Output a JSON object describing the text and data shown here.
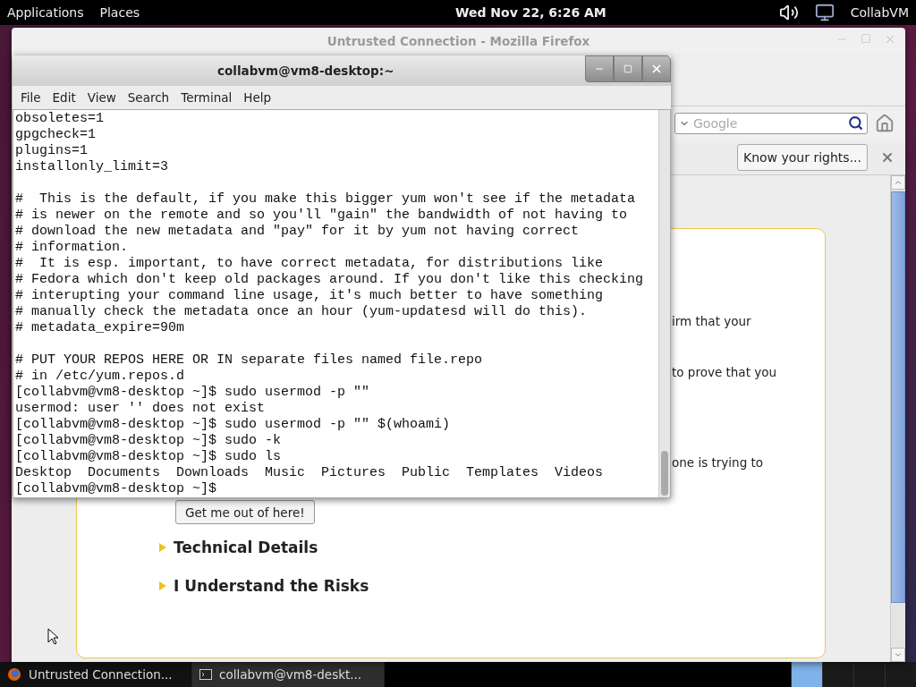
{
  "top_panel": {
    "menus": [
      "Applications",
      "Places"
    ],
    "clock": "Wed Nov 22,  6:26 AM",
    "user": "CollabVM"
  },
  "firefox": {
    "title": "Untrusted Connection - Mozilla Firefox",
    "search": {
      "placeholder": "Google"
    },
    "notification_button": "Know your rights...",
    "page": {
      "fragments": [
        "irm that your",
        "to prove that you",
        "one is trying to"
      ],
      "button": "Get me out of here!",
      "sections": [
        {
          "label": "Technical Details",
          "expanded": false
        },
        {
          "label": "I Understand the Risks",
          "expanded": false
        }
      ]
    }
  },
  "terminal": {
    "title": "collabvm@vm8-desktop:~",
    "menu": [
      "File",
      "Edit",
      "View",
      "Search",
      "Terminal",
      "Help"
    ],
    "blocks": [
      [
        "obsoletes=1",
        "gpgcheck=1",
        "plugins=1",
        "installonly_limit=3"
      ],
      [
        "#  This is the default, if you make this bigger yum won't see if the metadata",
        "# is newer on the remote and so you'll \"gain\" the bandwidth of not having to",
        "# download the new metadata and \"pay\" for it by yum not having correct",
        "# information.",
        "#  It is esp. important, to have correct metadata, for distributions like",
        "# Fedora which don't keep old packages around. If you don't like this checking",
        "# interupting your command line usage, it's much better to have something",
        "# manually check the metadata once an hour (yum-updatesd will do this).",
        "# metadata_expire=90m"
      ],
      [
        "# PUT YOUR REPOS HERE OR IN separate files named file.repo",
        "# in /etc/yum.repos.d",
        "[collabvm@vm8-desktop ~]$ sudo usermod -p \"\"",
        "usermod: user '' does not exist",
        "[collabvm@vm8-desktop ~]$ sudo usermod -p \"\" $(whoami)",
        "[collabvm@vm8-desktop ~]$ sudo -k",
        "[collabvm@vm8-desktop ~]$ sudo ls",
        "Desktop  Documents  Downloads  Music  Pictures  Public  Templates  Videos",
        "[collabvm@vm8-desktop ~]$"
      ]
    ]
  },
  "taskbar": {
    "items": [
      {
        "kind": "browser",
        "label": "Untrusted Connection...",
        "selected": false
      },
      {
        "kind": "terminal",
        "label": "collabvm@vm8-deskt...",
        "selected": true
      }
    ]
  }
}
